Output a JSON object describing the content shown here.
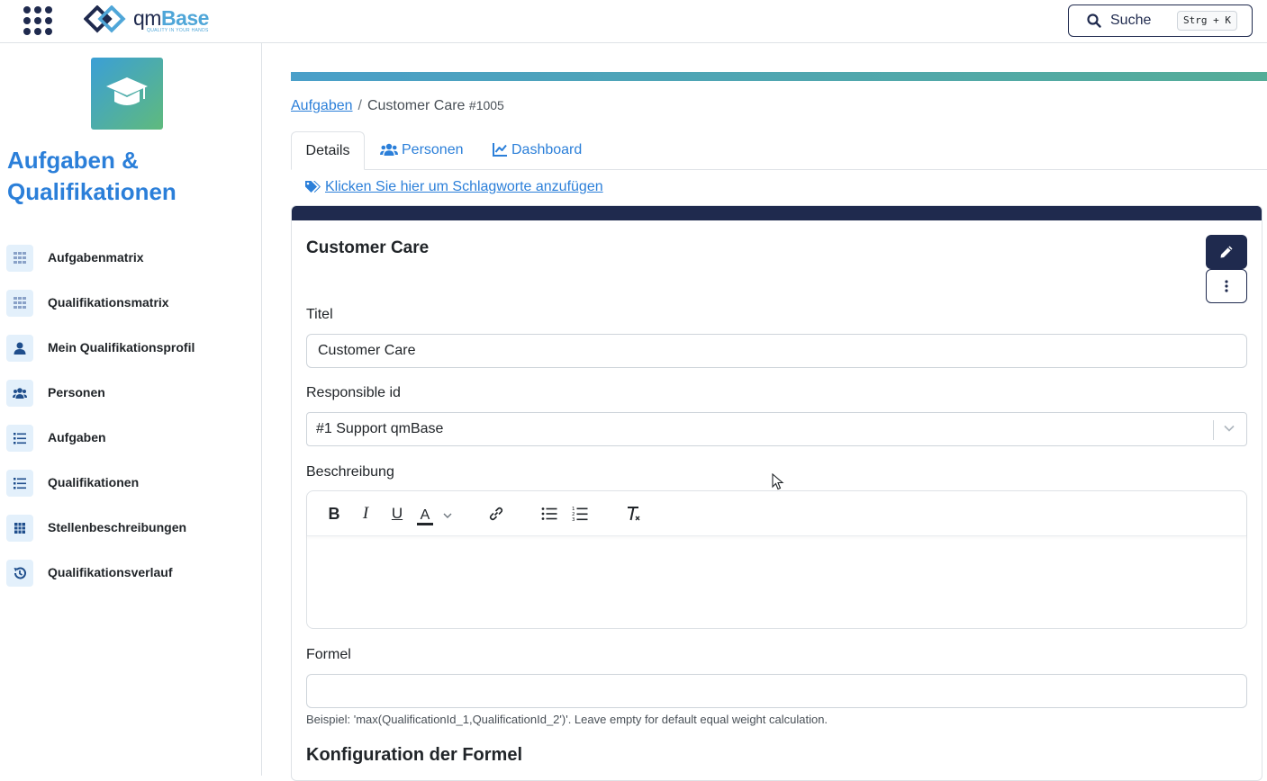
{
  "header": {
    "logo_name": "qm",
    "logo_name_bold": "Base",
    "logo_tagline": "QUALITY IN YOUR HANDS",
    "search_label": "Suche",
    "search_shortcut": "Strg + K"
  },
  "sidebar": {
    "module_title": "Aufgaben & Qualifikationen",
    "items": [
      {
        "label": "Aufgabenmatrix",
        "icon": "matrix-icon"
      },
      {
        "label": "Qualifikationsmatrix",
        "icon": "matrix-icon"
      },
      {
        "label": "Mein Qualifikationsprofil",
        "icon": "user-icon"
      },
      {
        "label": "Personen",
        "icon": "users-icon"
      },
      {
        "label": "Aufgaben",
        "icon": "list-icon"
      },
      {
        "label": "Qualifikationen",
        "icon": "list-icon"
      },
      {
        "label": "Stellenbeschreibungen",
        "icon": "grid-icon"
      },
      {
        "label": "Qualifikationsverlauf",
        "icon": "history-icon"
      }
    ]
  },
  "breadcrumb": {
    "parent": "Aufgaben",
    "current": "Customer Care",
    "current_id": "#1005"
  },
  "tabs": {
    "details": "Details",
    "persons": "Personen",
    "dashboard": "Dashboard"
  },
  "tags_link": "Klicken Sie hier um Schlagworte anzufügen",
  "card": {
    "title": "Customer Care",
    "title_label": "Titel",
    "title_value": "Customer Care",
    "responsible_label": "Responsible id",
    "responsible_value": "#1 Support qmBase",
    "description_label": "Beschreibung",
    "description_value": "",
    "formula_label": "Formel",
    "formula_value": "",
    "formula_hint": "Beispiel: 'max(QualificationId_1,QualificationId_2')'. Leave empty for default equal weight calculation.",
    "config_title": "Konfiguration der Formel"
  },
  "colors": {
    "navy": "#1f2a4e",
    "link": "#2b7fd9",
    "progress_start": "#4a9fc9",
    "progress_end": "#55ad98"
  }
}
